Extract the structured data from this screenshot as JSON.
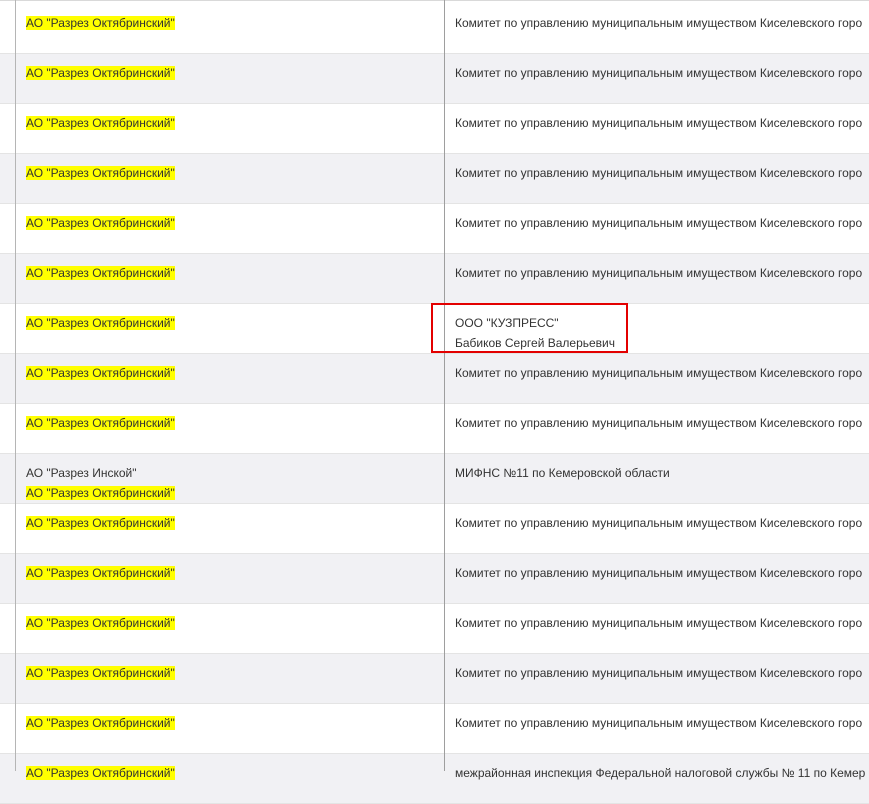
{
  "colors": {
    "highlight": "#ffff00",
    "annotation_box": "#e30000",
    "row_shade": "#f1f1f4",
    "text": "#333333"
  },
  "rows": [
    {
      "company": [
        "АО \"Разрез Октябринский\""
      ],
      "company_highlight": [
        true
      ],
      "owner": [
        "Комитет по управлению муниципальным имуществом Киселевского горо"
      ]
    },
    {
      "company": [
        "АО \"Разрез Октябринский\""
      ],
      "company_highlight": [
        true
      ],
      "owner": [
        "Комитет по управлению муниципальным имуществом Киселевского горо"
      ]
    },
    {
      "company": [
        "АО \"Разрез Октябринский\""
      ],
      "company_highlight": [
        true
      ],
      "owner": [
        "Комитет по управлению муниципальным имуществом Киселевского горо"
      ]
    },
    {
      "company": [
        "АО \"Разрез Октябринский\""
      ],
      "company_highlight": [
        true
      ],
      "owner": [
        "Комитет по управлению муниципальным имуществом Киселевского горо"
      ]
    },
    {
      "company": [
        "АО \"Разрез Октябринский\""
      ],
      "company_highlight": [
        true
      ],
      "owner": [
        "Комитет по управлению муниципальным имуществом Киселевского горо"
      ]
    },
    {
      "company": [
        "АО \"Разрез Октябринский\""
      ],
      "company_highlight": [
        true
      ],
      "owner": [
        "Комитет по управлению муниципальным имуществом Киселевского горо"
      ]
    },
    {
      "company": [
        "АО \"Разрез Октябринский\""
      ],
      "company_highlight": [
        true
      ],
      "owner": [
        "ООО \"КУЗПРЕСС\"",
        "Бабиков Сергей Валерьевич"
      ],
      "annotated": true
    },
    {
      "company": [
        "АО \"Разрез Октябринский\""
      ],
      "company_highlight": [
        true
      ],
      "owner": [
        "Комитет по управлению муниципальным имуществом Киселевского горо"
      ]
    },
    {
      "company": [
        "АО \"Разрез Октябринский\""
      ],
      "company_highlight": [
        true
      ],
      "owner": [
        "Комитет по управлению муниципальным имуществом Киселевского горо"
      ]
    },
    {
      "company": [
        "АО \"Разрез Инской\"",
        "АО \"Разрез Октябринский\""
      ],
      "company_highlight": [
        false,
        true
      ],
      "owner": [
        "МИФНС №11 по Кемеровской области"
      ]
    },
    {
      "company": [
        "АО \"Разрез Октябринский\""
      ],
      "company_highlight": [
        true
      ],
      "owner": [
        "Комитет по управлению муниципальным имуществом Киселевского горо"
      ]
    },
    {
      "company": [
        "АО \"Разрез Октябринский\""
      ],
      "company_highlight": [
        true
      ],
      "owner": [
        "Комитет по управлению муниципальным имуществом Киселевского горо"
      ]
    },
    {
      "company": [
        "АО \"Разрез Октябринский\""
      ],
      "company_highlight": [
        true
      ],
      "owner": [
        "Комитет по управлению муниципальным имуществом Киселевского горо"
      ]
    },
    {
      "company": [
        "АО \"Разрез Октябринский\""
      ],
      "company_highlight": [
        true
      ],
      "owner": [
        "Комитет по управлению муниципальным имуществом Киселевского горо"
      ]
    },
    {
      "company": [
        "АО \"Разрез Октябринский\""
      ],
      "company_highlight": [
        true
      ],
      "owner": [
        "Комитет по управлению муниципальным имуществом Киселевского горо"
      ]
    },
    {
      "company": [
        "АО \"Разрез Октябринский\""
      ],
      "company_highlight": [
        true
      ],
      "owner": [
        "межрайонная инспекция Федеральной налоговой службы № 11 по Кемер"
      ]
    }
  ]
}
